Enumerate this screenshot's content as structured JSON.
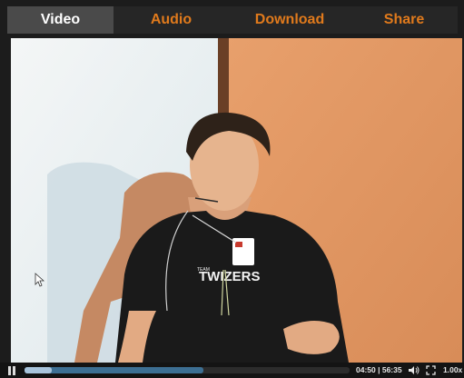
{
  "tabs": [
    {
      "label": "Video",
      "active": true
    },
    {
      "label": "Audio",
      "active": false
    },
    {
      "label": "Download",
      "active": false
    },
    {
      "label": "Share",
      "active": false
    }
  ],
  "player": {
    "current_time": "04:50",
    "duration": "56:35",
    "time_display": "04:50 | 56:35",
    "speed": "1.00x",
    "progress": 0.085,
    "buffered": 0.55,
    "state": "playing"
  },
  "video_frame": {
    "shirt_text": "TWIZERS",
    "shirt_small_text": "TEAM"
  },
  "icons": {
    "pause": "pause-icon",
    "volume": "speaker-icon",
    "fullscreen": "fullscreen-icon",
    "cursor": "mouse-pointer-icon"
  },
  "colors": {
    "active_tab_bg": "#4a4a4a",
    "tab_text": "#e07a1c",
    "bar_bg": "#262626",
    "seek_buffer": "#3d6f93",
    "seek_played": "#a8c4dc"
  }
}
